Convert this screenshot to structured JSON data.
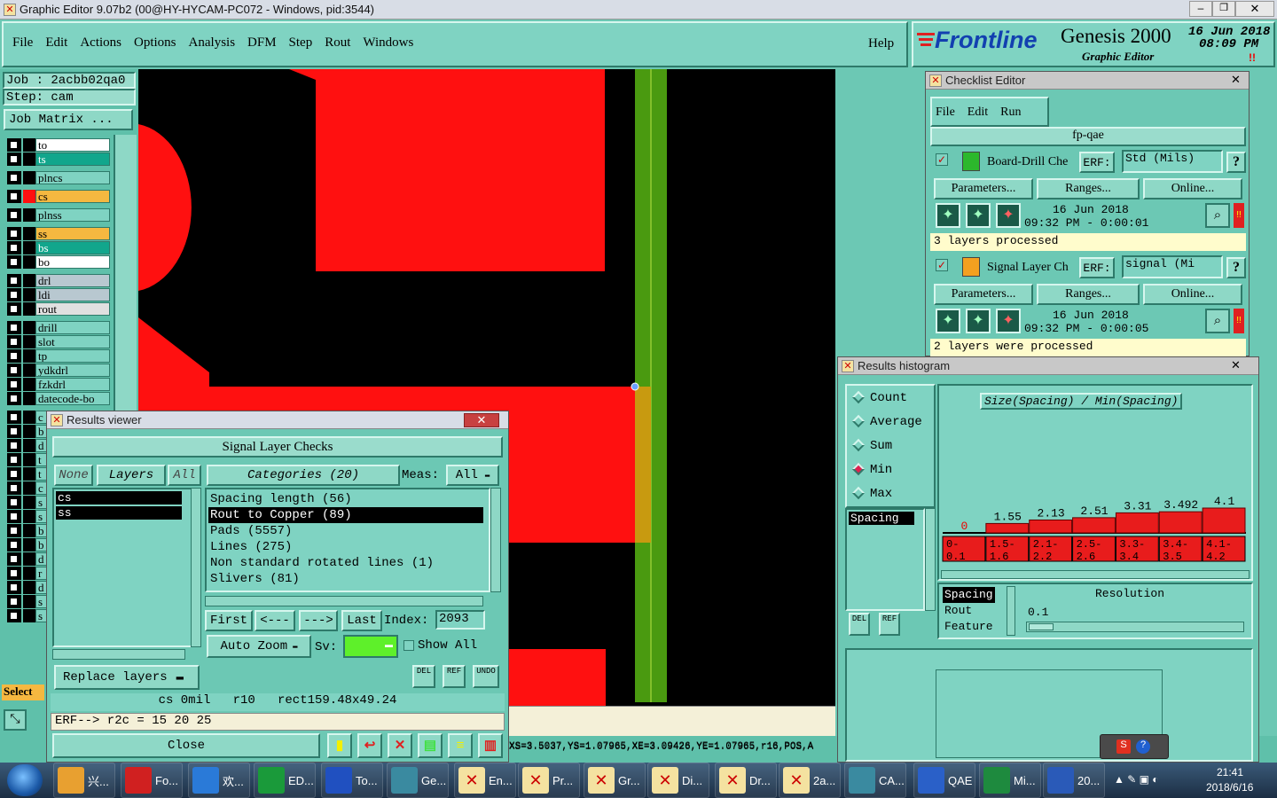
{
  "titlebar": {
    "title": "Graphic Editor 9.07b2 (00@HY-HYCAM-PC072 - Windows, pid:3544)"
  },
  "menu": [
    "File",
    "Edit",
    "Actions",
    "Options",
    "Analysis",
    "DFM",
    "Step",
    "Rout",
    "Windows"
  ],
  "help": "Help",
  "brand": {
    "logo": "Frontline",
    "product": "Genesis 2000",
    "subtitle": "Graphic Editor",
    "date": "16 Jun 2018",
    "time": "08:09 PM",
    "alert": "!!"
  },
  "job": {
    "job_line": "Job : 2acbb02qa0",
    "step_line": "Step: cam",
    "matrix_btn": "Job Matrix ..."
  },
  "layers": [
    {
      "name": "to",
      "color": "#ffffff"
    },
    {
      "name": "ts",
      "color": "#12a68c"
    },
    {
      "name": "plncs",
      "color": "#7fd3c2"
    },
    {
      "name": "cs",
      "color": "#f5b840"
    },
    {
      "name": "plnss",
      "color": "#7fd3c2"
    },
    {
      "name": "ss",
      "color": "#f5b840"
    },
    {
      "name": "bs",
      "color": "#12a68c"
    },
    {
      "name": "bo",
      "color": "#ffffff"
    },
    {
      "name": "drl",
      "color": "#b8c8d0"
    },
    {
      "name": "ldi",
      "color": "#b8c8d0"
    },
    {
      "name": "rout",
      "color": "#e0e0e0"
    },
    {
      "name": "drill",
      "color": "#7fd3c2"
    },
    {
      "name": "slot",
      "color": "#7fd3c2"
    },
    {
      "name": "tp",
      "color": "#7fd3c2"
    },
    {
      "name": "ydkdrl",
      "color": "#7fd3c2"
    },
    {
      "name": "fzkdrl",
      "color": "#7fd3c2"
    },
    {
      "name": "datecode-bo",
      "color": "#7fd3c2"
    }
  ],
  "layer_stubs": [
    "c",
    "b",
    "d",
    "t",
    "t",
    "c",
    "s",
    "s",
    "b",
    "b",
    "d",
    "r",
    "d",
    "s",
    "s"
  ],
  "select_label": "Select",
  "status_line": "XS=3.5037,YS=1.07965,XE=3.09426,YE=1.07965,r16,POS,A",
  "results_viewer": {
    "title": "Results viewer",
    "header": "Signal Layer Checks",
    "none_btn": "None",
    "layers_btn": "Layers",
    "all_btn": "All",
    "layers": [
      "cs",
      "ss"
    ],
    "categories_btn": "Categories (20)",
    "meas_label": "Meas:",
    "meas_value": "All",
    "categories": [
      "Spacing length (56)",
      "Rout to Copper (89)",
      "Pads (5557)",
      "Lines (275)",
      "Non standard rotated lines (1)",
      "Slivers (81)"
    ],
    "first": "First",
    "prev": "<---",
    "next": "--->",
    "last": "Last",
    "index_label": "Index:",
    "index_value": "2093",
    "auto_zoom": "Auto Zoom",
    "sv_label": "Sv:",
    "show_all": "Show All",
    "replace_layers": "Replace layers",
    "del": "DEL",
    "ref": "REF",
    "undo": "UNDO",
    "info_line": "cs 0mil   r10   rect159.48x49.24",
    "erf_line": "ERF--> r2c = 15 20 25",
    "close": "Close"
  },
  "checklist": {
    "title": "Checklist Editor",
    "menu": [
      "File",
      "Edit",
      "Run"
    ],
    "name": "fp-qae",
    "items": [
      {
        "label": "Board-Drill Che",
        "erf_label": "ERF:",
        "erf_value": "Std (Mils)",
        "q": "?",
        "params": "Parameters...",
        "ranges": "Ranges...",
        "online": "Online...",
        "date": "16 Jun 2018",
        "time": "09:32 PM - 0:00:01",
        "status": "3 layers processed"
      },
      {
        "label": "Signal Layer Ch",
        "erf_label": "ERF:",
        "erf_value": "signal (Mi",
        "q": "?",
        "params": "Parameters...",
        "ranges": "Ranges...",
        "online": "Online...",
        "date": "16 Jun 2018",
        "time": "09:32 PM - 0:00:05",
        "status": "2 layers were processed"
      }
    ]
  },
  "histogram": {
    "title": "Results histogram",
    "modes": [
      "Count",
      "Average",
      "Sum",
      "Min",
      "Max"
    ],
    "selected_mode": "Min",
    "list": [
      "Spacing"
    ],
    "chart_title": "Size(Spacing) / Min(Spacing)",
    "chart_data": {
      "type": "bar",
      "categories": [
        "0-0.1",
        "1.5-1.6",
        "2.1-2.2",
        "2.5-2.6",
        "3.3-3.4",
        "3.4-3.5",
        "4.1-4.2"
      ],
      "values": [
        0,
        1.55,
        2.13,
        2.51,
        3.31,
        3.492,
        4.1
      ],
      "value_labels": [
        "0",
        "1.55",
        "2.13",
        "2.51",
        "3.31",
        "3.492",
        "4.1"
      ],
      "bins": [
        "0-\n0.1",
        "1.5-\n1.6",
        "2.1-\n2.2",
        "2.5-\n2.6",
        "3.3-\n3.4",
        "3.4-\n3.5",
        "4.1-\n4.2"
      ]
    },
    "sub_list": [
      "Spacing",
      "Rout",
      "Feature"
    ],
    "resolution_label": "Resolution",
    "resolution_value": "0.1",
    "del": "DEL",
    "ref": "REF"
  },
  "taskbar": {
    "items": [
      {
        "label": "兴...",
        "color": "#e8a030"
      },
      {
        "label": "Fo...",
        "color": "#d02020"
      },
      {
        "label": "欢...",
        "color": "#2a7ad8"
      },
      {
        "label": "ED...",
        "color": "#1a9a3a"
      },
      {
        "label": "To...",
        "color": "#2050c0"
      },
      {
        "label": "Ge...",
        "color": "#3a8aa0"
      },
      {
        "label": "En...",
        "color": "#f4e2a0"
      },
      {
        "label": "Pr...",
        "color": "#f4e2a0"
      },
      {
        "label": "Gr...",
        "color": "#f4e2a0"
      },
      {
        "label": "Di...",
        "color": "#f4e2a0"
      },
      {
        "label": "Dr...",
        "color": "#f4e2a0"
      },
      {
        "label": "2a...",
        "color": "#f4e2a0"
      },
      {
        "label": "CA...",
        "color": "#3a8aa0"
      },
      {
        "label": "QAE",
        "color": "#2a60c8"
      },
      {
        "label": "Mi...",
        "color": "#1e8a3e"
      },
      {
        "label": "20...",
        "color": "#2a5ab8"
      }
    ],
    "clock_time": "21:41",
    "clock_date": "2018/6/16"
  }
}
